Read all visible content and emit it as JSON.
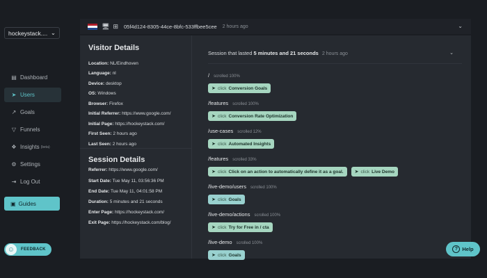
{
  "workspace": {
    "name": "hockeystack....",
    "chevron_icon": "chevron-down-icon"
  },
  "nav": [
    {
      "label": "Dashboard",
      "icon": "bars-icon"
    },
    {
      "label": "Users",
      "icon": "paper-plane-icon",
      "active": true
    },
    {
      "label": "Goals",
      "icon": "trend-icon"
    },
    {
      "label": "Funnels",
      "icon": "funnel-icon"
    },
    {
      "label": "Insights",
      "icon": "insights-icon",
      "badge": "(beta)"
    },
    {
      "label": "Settings",
      "icon": "gear-icon"
    },
    {
      "label": "Log Out",
      "icon": "logout-icon"
    }
  ],
  "guides": {
    "label": "Guides"
  },
  "feedback": {
    "label": "FEEDBACK"
  },
  "help": {
    "label": "Help"
  },
  "topbar": {
    "flag_colors": [
      "#ae1c28",
      "#ffffff",
      "#21468b"
    ],
    "visitor_id": "05f4d124-8305-44ce-8bfc-533ffbee5cee",
    "time": "2 hours ago"
  },
  "visitor": {
    "title": "Visitor Details",
    "rows": [
      {
        "label": "Location:",
        "value": "NL/Eindhoven"
      },
      {
        "label": "Language:",
        "value": "nl"
      },
      {
        "label": "Device:",
        "value": "desktop"
      },
      {
        "label": "OS:",
        "value": "Windows"
      },
      {
        "label": "Browser:",
        "value": "Firefox"
      },
      {
        "label": "Initial Referrer:",
        "value": "https://www.google.com/"
      },
      {
        "label": "Initial Page:",
        "value": "https://hockeystack.com/"
      },
      {
        "label": "First Seen:",
        "value": "2 hours ago"
      },
      {
        "label": "Last Seen:",
        "value": "2 hours ago"
      }
    ]
  },
  "session": {
    "title": "Session Details",
    "rows": [
      {
        "label": "Referrer:",
        "value": "https://www.google.com/"
      },
      {
        "label": "Start Date:",
        "value": "Tue May 11, 03:56:36 PM"
      },
      {
        "label": "End Date:",
        "value": "Tue May 11, 04:01:58 PM"
      },
      {
        "label": "Duration:",
        "value": "5 minutes and 21 seconds"
      },
      {
        "label": "Enter Page:",
        "value": "https://hockeystack.com/"
      },
      {
        "label": "Exit Page:",
        "value": "https://hockeystack.com/blog/"
      }
    ]
  },
  "session_header": {
    "prefix": "Session that lasted",
    "duration": "5 minutes and 21 seconds",
    "time": "2 hours ago"
  },
  "pages": [
    {
      "path": "/",
      "scroll": "scrolled 100%",
      "chips": [
        {
          "verb": "click",
          "target": "Conversion Goals",
          "style": "green"
        }
      ]
    },
    {
      "path": "/features",
      "scroll": "scrolled 100%",
      "chips": [
        {
          "verb": "click",
          "target": "Conversion Rate Optimization",
          "style": "green"
        }
      ]
    },
    {
      "path": "/use-cases",
      "scroll": "scrolled 12%",
      "chips": [
        {
          "verb": "click",
          "target": "Automated Insights",
          "style": "green"
        }
      ]
    },
    {
      "path": "/features",
      "scroll": "scrolled 33%",
      "chips": [
        {
          "verb": "click",
          "target": "Click on an action to automatically define it as a goal.",
          "style": "green"
        },
        {
          "verb": "click",
          "target": "Live Demo",
          "style": "green"
        }
      ]
    },
    {
      "path": "/live-demo/users",
      "scroll": "scrolled 100%",
      "chips": [
        {
          "verb": "click",
          "target": "Goals",
          "style": "teal"
        }
      ]
    },
    {
      "path": "/live-demo/actions",
      "scroll": "scrolled 100%",
      "chips": [
        {
          "verb": "click",
          "target": "Try for Free in / cta",
          "style": "green"
        }
      ]
    },
    {
      "path": "/live-demo",
      "scroll": "scrolled 100%",
      "chips": [
        {
          "verb": "click",
          "target": "Goals",
          "style": "teal"
        }
      ]
    }
  ]
}
